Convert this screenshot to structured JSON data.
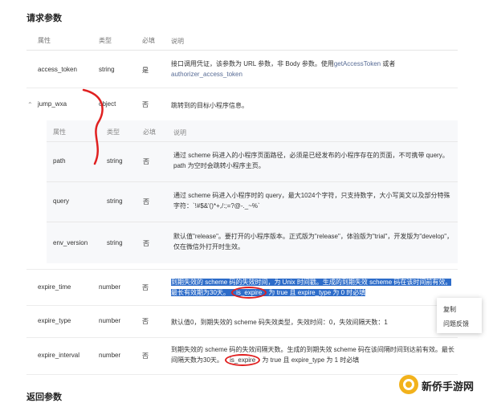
{
  "section_request": "请求参数",
  "section_return": "返回参数",
  "headers": {
    "attr": "属性",
    "type": "类型",
    "required": "必填",
    "desc": "说明"
  },
  "rows": {
    "access_token": {
      "name": "access_token",
      "type": "string",
      "required": "是",
      "desc1": "接口调用凭证，该参数为 URL 参数，非 Body 参数。使用",
      "link1": "getAccessToken",
      "desc2": " 或者",
      "link2": "authorizer_access_token"
    },
    "jump_wxa": {
      "name": "jump_wxa",
      "type": "object",
      "required": "否",
      "desc": "跳转到的目标小程序信息。"
    },
    "expire_time": {
      "name": "expire_time",
      "type": "number",
      "required": "否",
      "desc1": "到期失效的 scheme 码的失效时间，为 Unix 时间戳。生成的到期失效 scheme 码在该时间前有效。最长有效期为30天。",
      "badge": "is_expire",
      "desc2": " 为 true 且 expire_type 为 0 时必填"
    },
    "expire_type": {
      "name": "expire_type",
      "type": "number",
      "required": "否",
      "desc": "默认值0，到期失效的 scheme 码失效类型，失效时间：0，失效间隔天数：1"
    },
    "expire_interval": {
      "name": "expire_interval",
      "type": "number",
      "required": "否",
      "desc1": "到期失效的 scheme 码的失效间隔天数。生成的到期失效 scheme 码在该间隔时间到达前有效。最长间隔天数为30天。",
      "badge": "is_expire",
      "desc2": " 为 true 且 expire_type 为 1 时必填"
    }
  },
  "subheaders": {
    "attr": "属性",
    "type": "类型",
    "required": "必填",
    "desc": "说明"
  },
  "subrows": {
    "path": {
      "name": "path",
      "type": "string",
      "required": "否",
      "desc": "通过 scheme 码进入的小程序页面路径，必须是已经发布的小程序存在的页面，不可携带 query。path 为空时会跳转小程序主页。"
    },
    "query": {
      "name": "query",
      "type": "string",
      "required": "否",
      "desc": "通过 scheme 码进入小程序时的 query，最大1024个字符，只支持数字，大小写英文以及部分特殊字符：`!#$&'()*+,/:;=?@-._~%`"
    },
    "env_version": {
      "name": "env_version",
      "type": "string",
      "required": "否",
      "desc": "默认值\"release\"。要打开的小程序版本。正式版为\"release\"，体验版为\"trial\"，开发版为\"develop\"，仅在微信外打开时生效。"
    }
  },
  "context_menu": {
    "copy": "复制",
    "feedback": "问题反馈"
  },
  "watermark": "新侨手游网"
}
